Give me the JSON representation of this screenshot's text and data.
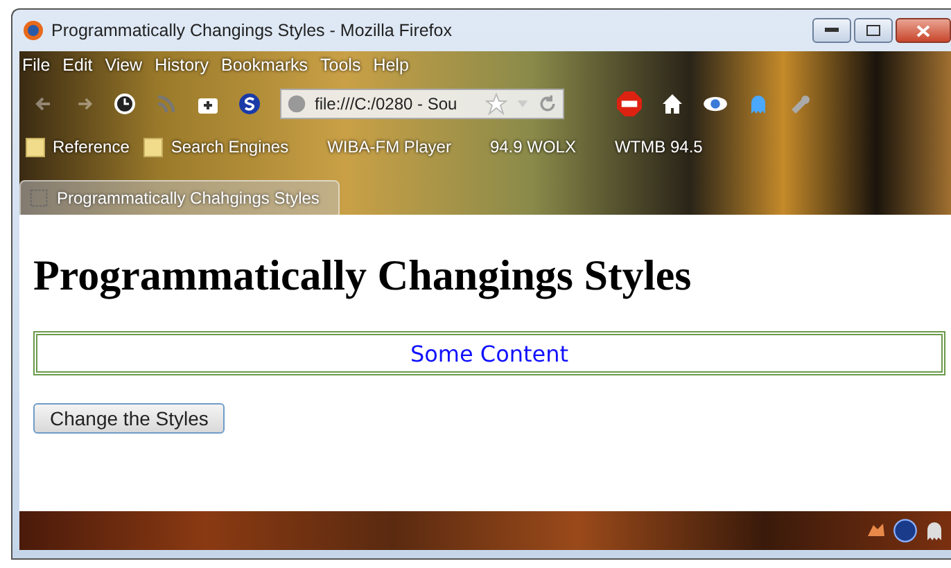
{
  "window": {
    "title": "Programmatically Changings Styles - Mozilla Firefox"
  },
  "menu": [
    "File",
    "Edit",
    "View",
    "History",
    "Bookmarks",
    "Tools",
    "Help"
  ],
  "address_bar": {
    "value": "file:///C:/0280 - Sou"
  },
  "bookmarks": [
    {
      "label": "Reference",
      "kind": "folder"
    },
    {
      "label": "Search Engines",
      "kind": "folder"
    },
    {
      "label": "WIBA-FM Player",
      "kind": "page"
    },
    {
      "label": "94.9 WOLX",
      "kind": "page"
    },
    {
      "label": "WTMB 94.5",
      "kind": "page"
    }
  ],
  "tabs": [
    {
      "label": "Programmatically Chahgings Styles",
      "selected": true
    }
  ],
  "page": {
    "heading": "Programmatically Changings Styles",
    "content_box": "Some Content",
    "button": "Change the Styles"
  }
}
